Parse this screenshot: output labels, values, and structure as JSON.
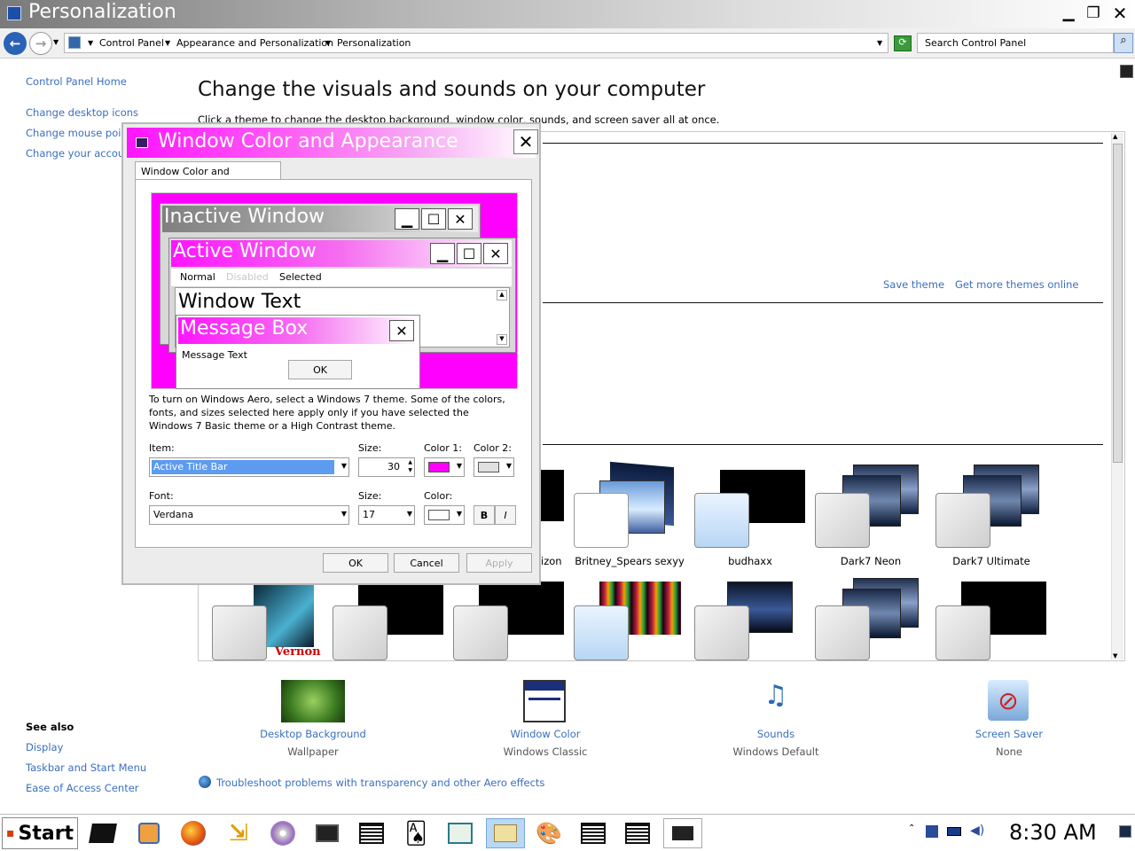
{
  "window": {
    "title": "Personalization",
    "minimize": "▁",
    "maximize": "❐",
    "close": "✕"
  },
  "address": {
    "crumbs": [
      "Control Panel",
      "Appearance and Personalization",
      "Personalization"
    ],
    "search_placeholder": "Search Control Panel"
  },
  "sidebar": {
    "home": "Control Panel Home",
    "links": [
      "Change desktop icons",
      "Change mouse poin",
      "Change your accour"
    ],
    "see_also_title": "See also",
    "see_also": [
      "Display",
      "Taskbar and Start Menu",
      "Ease of Access Center"
    ]
  },
  "main": {
    "heading": "Change the visuals and sounds on your computer",
    "subheading": "Click a theme to change the desktop background, window color, sounds, and screen saver all at once.",
    "save_theme": "Save theme",
    "get_more": "Get more themes online",
    "themes_row1": [
      "izon",
      "Britney_Spears sexyy",
      "budhaxx",
      "Dark7 Neon",
      "Dark7 Ultimate"
    ],
    "vernon_text": "Vernon",
    "troubleshoot": "Troubleshoot problems with transparency and other Aero effects"
  },
  "bottom": [
    {
      "label": "Desktop Background",
      "sub": "Wallpaper"
    },
    {
      "label": "Window Color",
      "sub": "Windows Classic"
    },
    {
      "label": "Sounds",
      "sub": "Windows Default"
    },
    {
      "label": "Screen Saver",
      "sub": "None"
    }
  ],
  "dialog": {
    "title": "Window Color and Appearance",
    "tab": "Window Color and Appearance",
    "inactive_title": "Inactive Window",
    "active_title": "Active Window",
    "menu": [
      "Normal",
      "Disabled",
      "Selected"
    ],
    "window_text": "Window Text",
    "msgbox_title": "Message Box",
    "msg_text": "Message Text",
    "ok_small": "OK",
    "info": "To turn on Windows Aero, select a Windows 7 theme.  Some of the colors, fonts, and sizes selected here apply only if you have selected the Windows 7 Basic theme or a High Contrast theme.",
    "item_label": "Item:",
    "size_label": "Size:",
    "color1_label": "Color 1:",
    "color2_label": "Color 2:",
    "item_value": "Active Title Bar",
    "size_value": "30",
    "font_label": "Font:",
    "font_size_label": "Size:",
    "color_label": "Color:",
    "font_value": "Verdana",
    "font_size_value": "17",
    "bold": "B",
    "italic": "I",
    "ok": "OK",
    "cancel": "Cancel",
    "apply": "Apply",
    "colors": {
      "color1": "#ff00ff",
      "color2": "#e0e0e0",
      "font_color": "#ffffff",
      "title_bar": "#ff14ff"
    }
  },
  "taskbar": {
    "start": "Start",
    "clock": "8:30 AM"
  }
}
